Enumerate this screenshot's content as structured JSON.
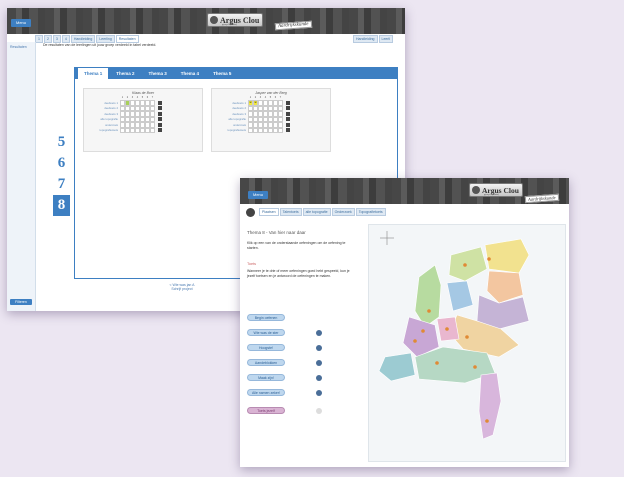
{
  "window1": {
    "menu_label": "Menu",
    "logo_title": "Argus Clou",
    "logo_sub": "groep 8 (basis)",
    "badge": "Aardrijkskunde",
    "tabs": [
      "1",
      "2",
      "3",
      "4",
      "Handleiding",
      "Leerling",
      "Resultaten"
    ],
    "right_tabs": [
      "Handleiding",
      "Leerli"
    ],
    "sidebar_title": "Resultaten",
    "sidebar_button": "Filteren",
    "intro": "De resultaten van de leerlingen uit jouw groep verdeeld in tabel verdeeld.",
    "theme_tabs": [
      "Thema 1",
      "Thema 2",
      "Thema 3",
      "Thema 4",
      "Thema 5"
    ],
    "grid_headers": [
      "1",
      "2",
      "3",
      "4",
      "5",
      "6",
      "7"
    ],
    "row_labels": [
      "deeltoets 1",
      "deeltoets 2",
      "deeltoets 3",
      "alle topografie",
      "onderzoek",
      "topografietoets"
    ],
    "students": [
      "Klaas de Boer",
      "Jasper van der Berg"
    ],
    "student2_marks": [
      "w",
      "w"
    ],
    "grade_numbers": [
      "5",
      "6",
      "7",
      "8"
    ],
    "footer_lines": [
      "< Wie was jan A",
      "Schrijf project"
    ]
  },
  "window2": {
    "menu_label": "Menu",
    "logo_title": "Argus Clou",
    "logo_sub": "groep 8 (basis)",
    "badge": "Aardrijkskunde",
    "tabs": [
      "Plaatsen",
      "Talentoets",
      "alle topografie",
      "Onderzoek",
      "Topografietoets"
    ],
    "section_title": "Thema 8 - Van hier naar daar",
    "intro_text": "Klik op een van de onderstaande oefeningen om de oefening te starten.",
    "tip_heading": "Toets",
    "tip_text": "Wanneer je te drie of meer oefeningen goed hebt gespeeld, kun je jezelf toetsen en je antwoord de oefeningen te maken.",
    "exercises": [
      "Begin oefenen",
      "Wie was de ster",
      "Hoogste!",
      "Aandeblokken",
      "Maak zijn!",
      "Alle namen zeker!"
    ],
    "test_button": "Toets jezelf"
  },
  "colors": {
    "accent": "#3d7fc2",
    "header_wood": "#4a4a4a"
  }
}
